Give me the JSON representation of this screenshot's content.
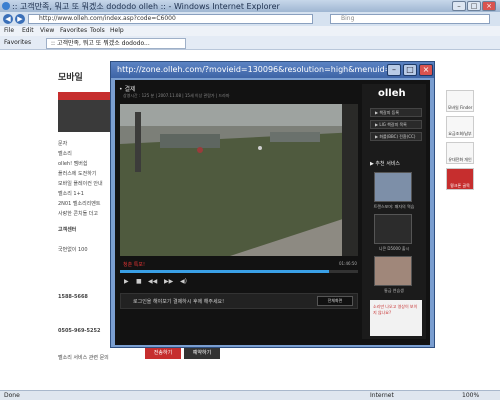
{
  "ie": {
    "title": ":: 고객만족, 뭐고 또 뭐겠소 dododo olleh :: - Windows Internet Explorer",
    "address": "http://www.olleh.com/index.asp?code=C6000",
    "search_placeholder": "Bing",
    "menu": [
      "File",
      "Edit",
      "View",
      "Favorites",
      "Tools",
      "Help"
    ],
    "favorites_label": "Favorites",
    "tab_label": ":: 고객만족, 뭐고 또 뭐겠소 dododo..."
  },
  "page": {
    "sidebar_title": "모바일",
    "sidebar_items": [
      "문자",
      "벨소리",
      "olleh! 멤버쉽",
      "플러스에 도전하기",
      "모바일 플레이컨 안내",
      "벨소리 1+1",
      "2N01 벨소리리멘트",
      "사랑한 콘치돌 더고",
      "고객센터",
      "국번없이 100",
      "1588-5668",
      "0505-969-5252",
      "벨소리 서비스 관련 문의"
    ],
    "btn_red": "전송하기",
    "btn_dark": "예약하기",
    "rail_items": [
      "모바일 Finder",
      "요금조회/납부",
      "유대전화 개인",
      "쿠폰 스텝",
      "윙크폰 골목"
    ]
  },
  "popup": {
    "title": "http://zone.olleh.com/?movieid=130096&resolution=high&menuid=1...",
    "player_head": "• 결제",
    "player_meta": "상영시간 : 125 분   |   2007.11.08   |   15세 이상 관람가   |   드라마",
    "caption": "청춘 특포!",
    "time": "01:46:50",
    "progress": 0.88,
    "controls": [
      "▶",
      "■",
      "◀◀",
      "▶▶",
      "◀)"
    ],
    "message": "로그인을 해야보기 결제하시 후에 해주세요!",
    "fullscreen_label": "전체화면",
    "logo": "olleh",
    "side_buttons": [
      "▶ 책갈피 등록",
      "▶ LIG 책갈피 목록",
      "▶ 화를(BBC) 전환(CC)"
    ],
    "recommend_title": "▶ 추천 서비스",
    "thumbs": [
      {
        "caption": "트랜스포머: 패자의 역습",
        "color": "#7d8fa8"
      },
      {
        "caption": "니콘 D5000 출시",
        "color": "#2c2c2c"
      },
      {
        "caption": "통금 연습생",
        "color": "#a0877a"
      }
    ],
    "ad_text": "소리만 나오고 영상이 보이지 않나요?"
  },
  "status": {
    "left": "Done",
    "zone": "Internet",
    "zoom": "100%"
  }
}
